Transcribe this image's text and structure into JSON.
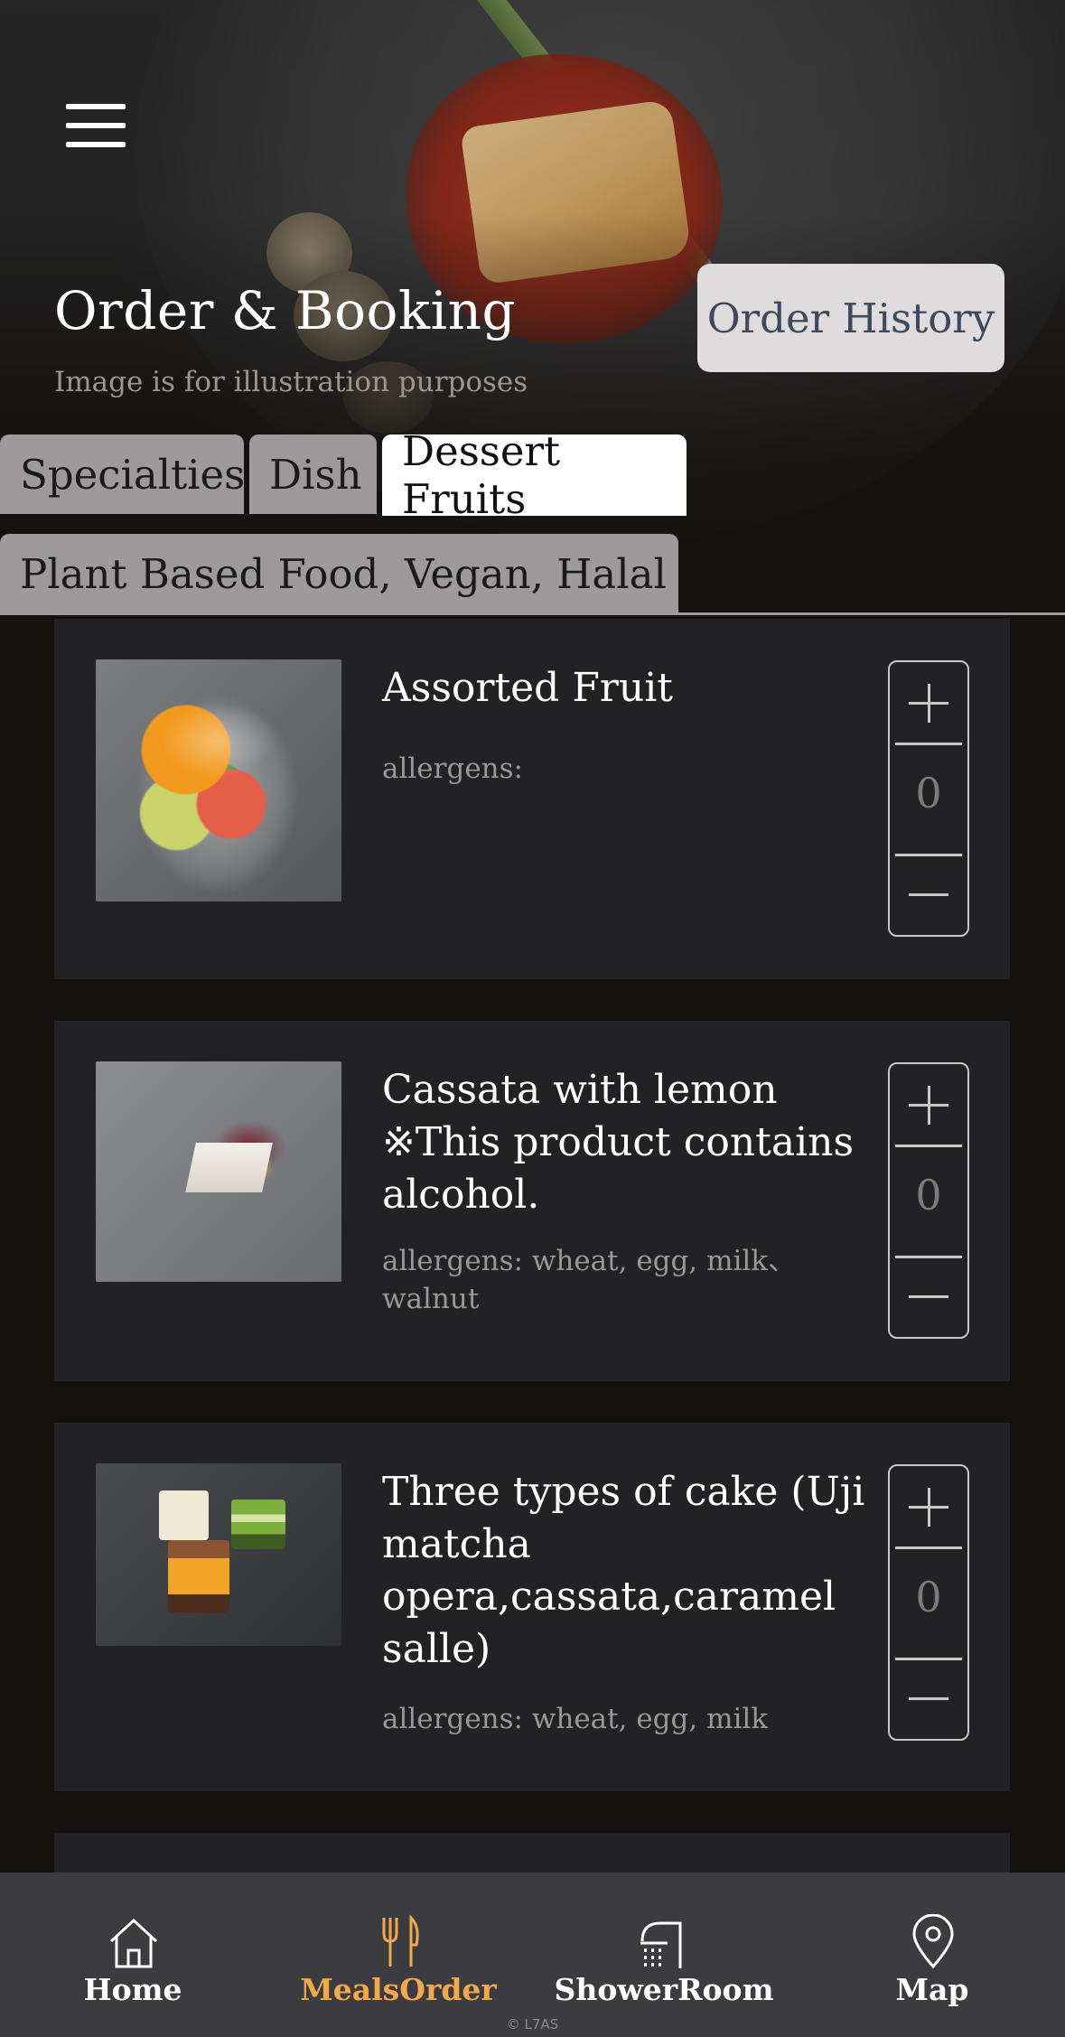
{
  "header": {
    "title": "Order & Booking",
    "subtitle": "Image is for illustration purposes",
    "order_history_label": "Order History",
    "menu_icon": "hamburger-menu-icon"
  },
  "tabs": [
    {
      "label": "Specialties",
      "active": false
    },
    {
      "label": "Dish",
      "active": false
    },
    {
      "label": "Dessert Fruits",
      "active": true
    },
    {
      "label": "Plant Based Food, Vegan, Halal",
      "active": false
    }
  ],
  "items": [
    {
      "name": "Assorted Fruit",
      "allergens": "allergens:",
      "quantity": "0",
      "image": "assorted-fruit-image"
    },
    {
      "name": "Cassata with lemon ※This product contains alcohol.",
      "allergens": "allergens:  wheat, egg, milk、walnut",
      "quantity": "0",
      "image": "cassata-image"
    },
    {
      "name": "Three types of cake (Uji matcha opera,cassata,caramel salle)",
      "allergens": "allergens: wheat, egg, milk",
      "quantity": "0",
      "image": "three-cakes-image"
    }
  ],
  "nav": [
    {
      "label": "Home",
      "icon": "home-icon",
      "active": false
    },
    {
      "label": "MealsOrder",
      "icon": "fork-knife-icon",
      "active": true
    },
    {
      "label": "ShowerRoom",
      "icon": "shower-icon",
      "active": false
    },
    {
      "label": "Map",
      "icon": "map-pin-icon",
      "active": false
    }
  ],
  "colors": {
    "background": "#141210",
    "card": "#222124",
    "accent": "#f2a94a",
    "tab_inactive": "#9c9a9b",
    "history_text": "#3e4a5c"
  },
  "copyright": "© L7AS"
}
